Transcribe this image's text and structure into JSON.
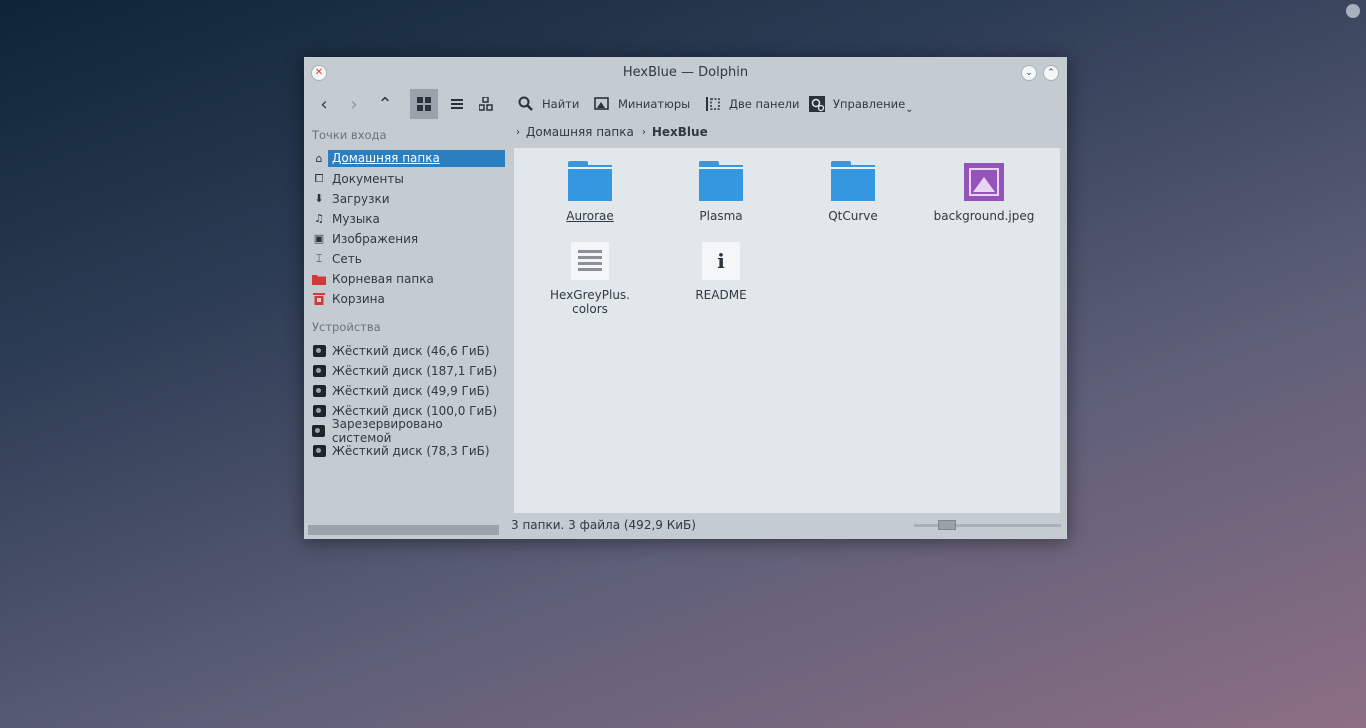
{
  "window": {
    "title": "HexBlue — Dolphin",
    "close_glyph": "✕",
    "minimize_glyph": "⌄",
    "maximize_glyph": "⌃"
  },
  "toolbar": {
    "back_glyph": "‹",
    "forward_glyph": "›",
    "up_glyph": "⌃",
    "find_label": "Найти",
    "preview_label": "Миниатюры",
    "split_label": "Две панели",
    "control_label": "Управление",
    "control_arrow": "⌄",
    "icons": [
      "back-icon",
      "forward-icon",
      "up-icon",
      "icons-view-icon",
      "details-view-icon",
      "compact-view-icon",
      "search-icon",
      "image-icon",
      "split-icon",
      "gear-icon"
    ]
  },
  "sidebar": {
    "places_header": "Точки входа",
    "places": [
      {
        "label": "Домашняя папка",
        "icon": "home-icon",
        "glyph": "⌂"
      },
      {
        "label": "Документы",
        "icon": "documents-icon",
        "glyph": "⧠"
      },
      {
        "label": "Загрузки",
        "icon": "downloads-icon",
        "glyph": "⬇"
      },
      {
        "label": "Музыка",
        "icon": "music-icon",
        "glyph": "♫"
      },
      {
        "label": "Изображения",
        "icon": "pictures-icon",
        "glyph": "▣"
      },
      {
        "label": "Сеть",
        "icon": "network-icon",
        "glyph": "⌶"
      },
      {
        "label": "Корневая папка",
        "icon": "root-folder-icon",
        "glyph": ""
      },
      {
        "label": "Корзина",
        "icon": "trash-icon",
        "glyph": "🗑"
      }
    ],
    "devices_header": "Устройства",
    "devices": [
      {
        "label": "Жёсткий диск (46,6 ГиБ)"
      },
      {
        "label": "Жёсткий диск (187,1 ГиБ)"
      },
      {
        "label": "Жёсткий диск (49,9 ГиБ)"
      },
      {
        "label": "Жёсткий диск (100,0 ГиБ)"
      },
      {
        "label": "Зарезервировано системой"
      },
      {
        "label": "Жёсткий диск (78,3 ГиБ)"
      }
    ]
  },
  "breadcrumb": {
    "sep": "›",
    "home": "Домашняя папка",
    "current": "HexBlue"
  },
  "files": [
    {
      "name": "Aurorae",
      "type": "folder"
    },
    {
      "name": "Plasma",
      "type": "folder"
    },
    {
      "name": "QtCurve",
      "type": "folder"
    },
    {
      "name": "background.jpeg",
      "type": "image"
    },
    {
      "name_line1": "HexGreyPlus.",
      "name_line2": "colors",
      "type": "text"
    },
    {
      "name": "README",
      "type": "info",
      "glyph": "i"
    }
  ],
  "status": {
    "text": "3 папки. 3 файла (492,9 КиБ)"
  },
  "colors": {
    "accent": "#2a7fc0",
    "folder": "#3597e0",
    "image": "#9453b8",
    "window_bg": "#c4cbd1",
    "content_bg": "#e1e7ea"
  }
}
